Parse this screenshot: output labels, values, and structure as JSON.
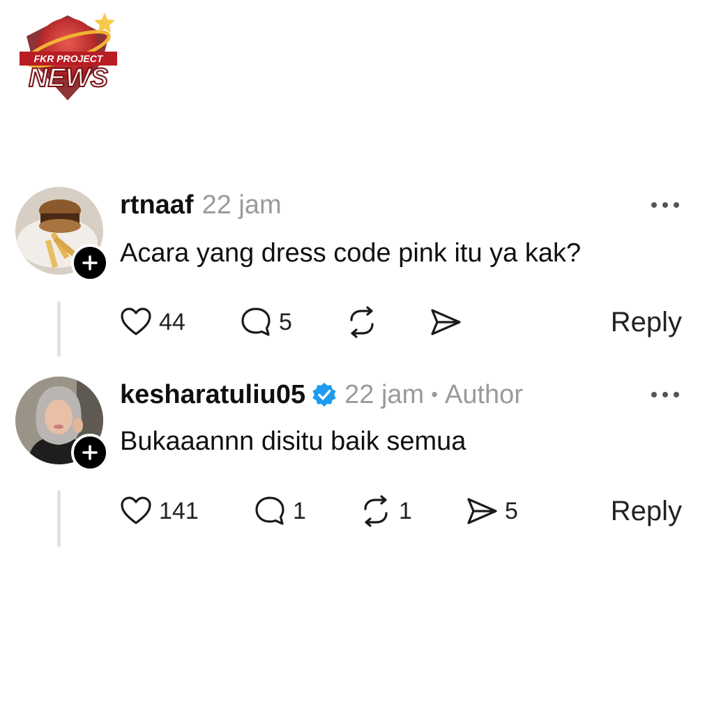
{
  "logo": {
    "line1": "FKR PROJECT",
    "line2": "NEWS"
  },
  "comments": [
    {
      "username": "rtnaaf",
      "time": "22 jam",
      "text": "Acara yang dress code pink itu ya kak?",
      "likes": "44",
      "replies": "5",
      "reposts": "",
      "shares": "",
      "reply_label": "Reply"
    },
    {
      "username": "kesharatuliu05",
      "time": "22 jam",
      "separator": "•",
      "role": "Author",
      "verified": true,
      "text": "Bukaaannn disitu baik semua",
      "likes": "141",
      "replies": "1",
      "reposts": "1",
      "shares": "5",
      "reply_label": "Reply"
    }
  ],
  "colors": {
    "verified": "#1d9bf0",
    "meta": "#9a9a9a",
    "thread_line": "#e2e2e2",
    "logo_red": "#c8262c"
  }
}
